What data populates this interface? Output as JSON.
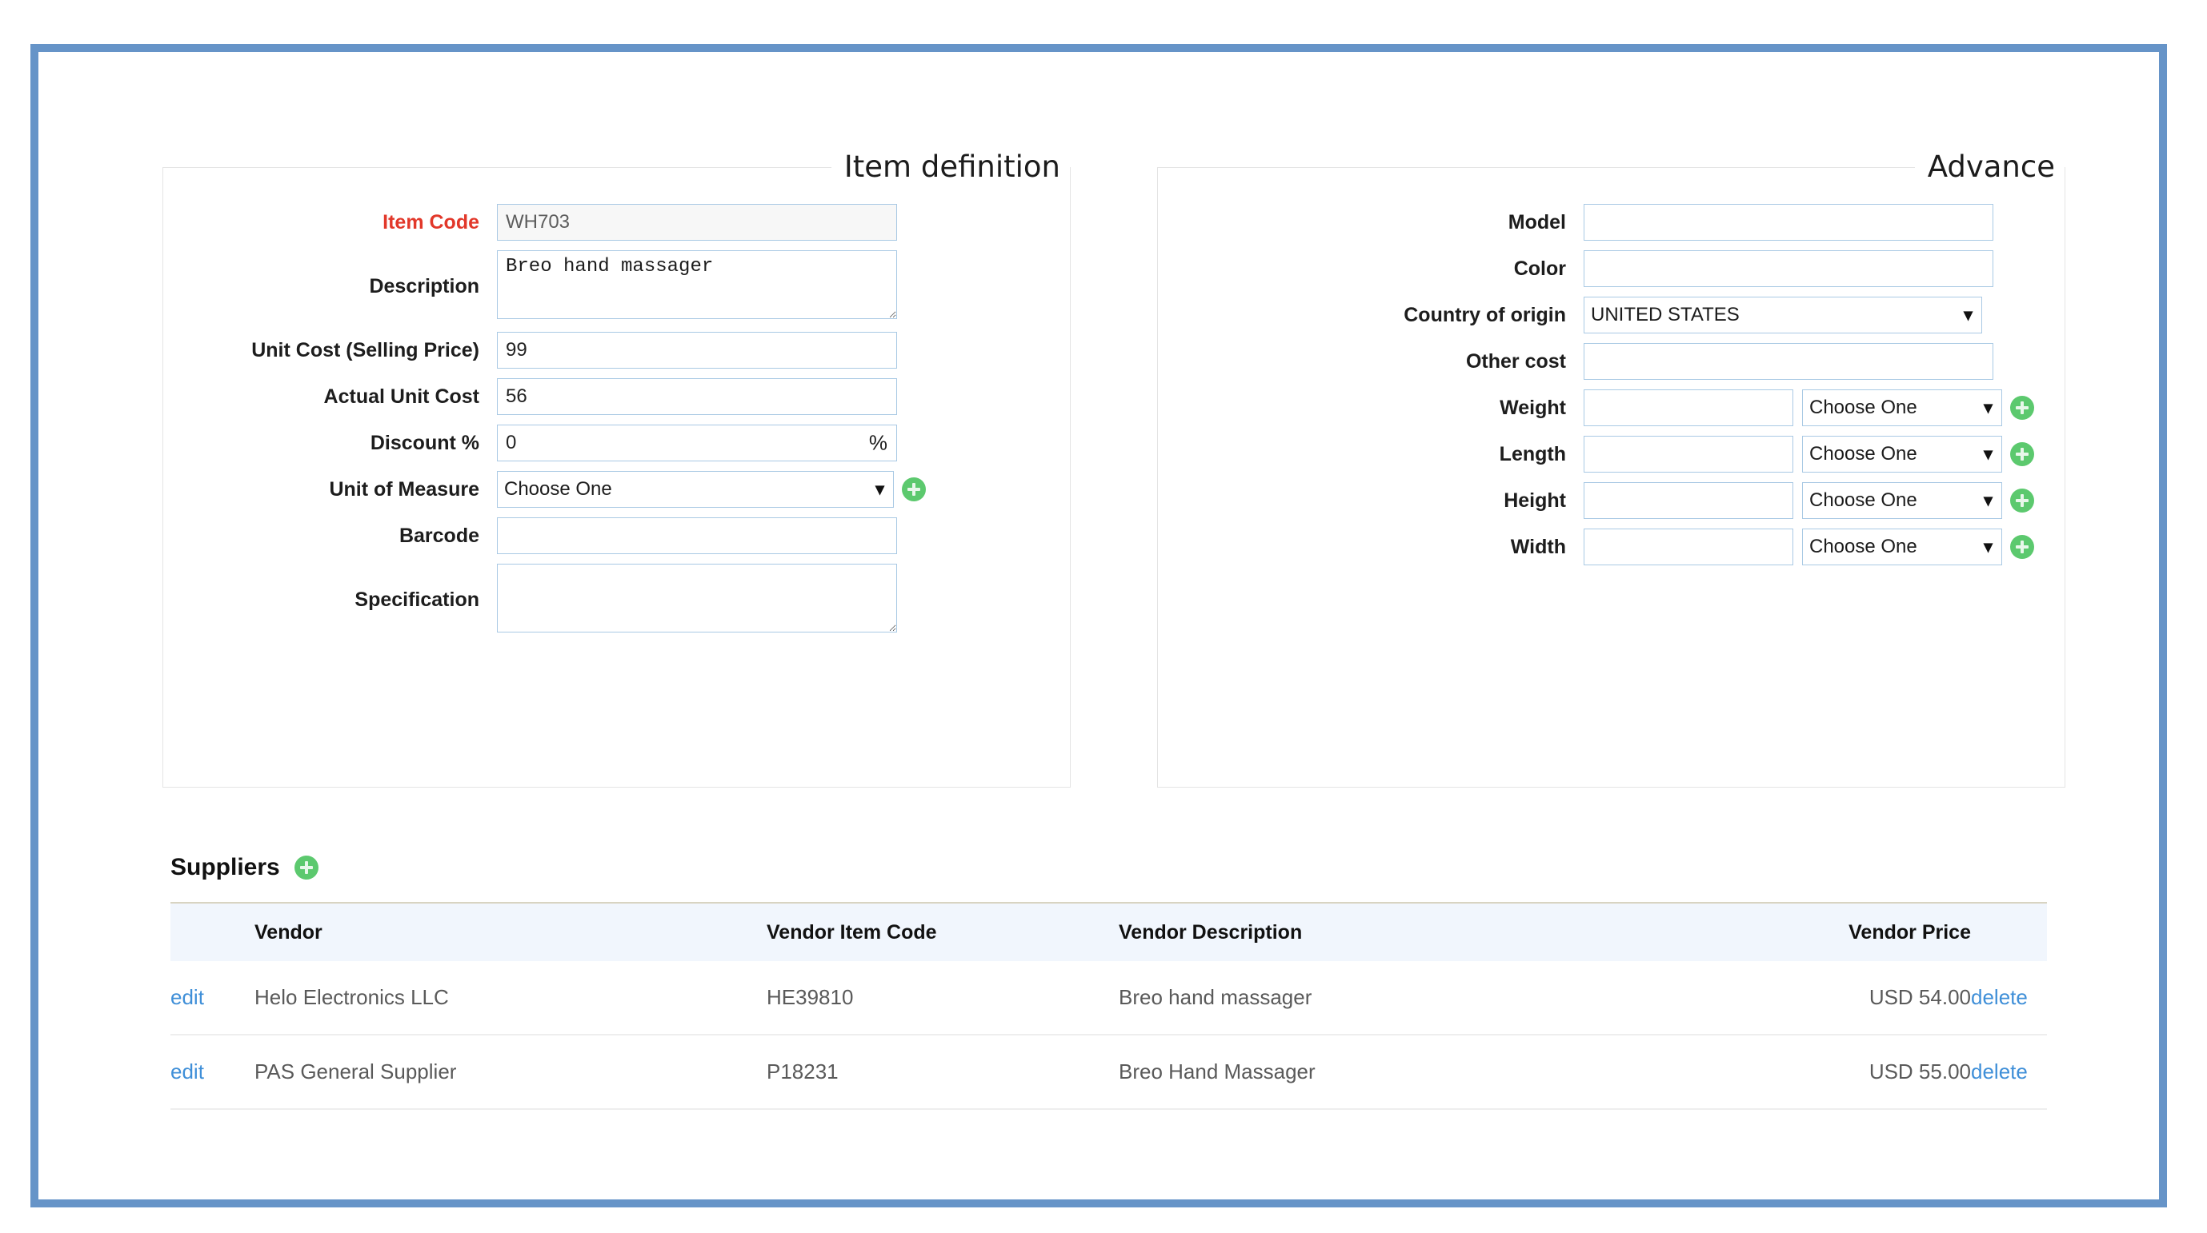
{
  "item_definition": {
    "legend": "Item definition",
    "fields": {
      "item_code": {
        "label": "Item Code",
        "value": "WH703",
        "required": true,
        "readonly": true
      },
      "description": {
        "label": "Description",
        "value": "Breo hand massager"
      },
      "unit_cost": {
        "label": "Unit Cost (Selling Price)",
        "value": "99"
      },
      "actual_unit_cost": {
        "label": "Actual Unit Cost",
        "value": "56"
      },
      "discount": {
        "label": "Discount %",
        "value": "0",
        "suffix": "%"
      },
      "unit_of_measure": {
        "label": "Unit of Measure",
        "selected": "Choose One",
        "options": [
          "Choose One"
        ],
        "add_icon": "plus-circle-icon"
      },
      "barcode": {
        "label": "Barcode",
        "value": ""
      },
      "specification": {
        "label": "Specification",
        "value": ""
      }
    }
  },
  "advance": {
    "legend": "Advance",
    "fields": {
      "model": {
        "label": "Model",
        "value": ""
      },
      "color": {
        "label": "Color",
        "value": ""
      },
      "country_of_origin": {
        "label": "Country of origin",
        "selected": "UNITED STATES",
        "options": [
          "UNITED STATES"
        ]
      },
      "other_cost": {
        "label": "Other cost",
        "value": ""
      },
      "weight": {
        "label": "Weight",
        "value": "",
        "unit_selected": "Choose One",
        "add_icon": "plus-circle-icon"
      },
      "length": {
        "label": "Length",
        "value": "",
        "unit_selected": "Choose One",
        "add_icon": "plus-circle-icon"
      },
      "height": {
        "label": "Height",
        "value": "",
        "unit_selected": "Choose One",
        "add_icon": "plus-circle-icon"
      },
      "width": {
        "label": "Width",
        "value": "",
        "unit_selected": "Choose One",
        "add_icon": "plus-circle-icon"
      }
    }
  },
  "suppliers": {
    "title": "Suppliers",
    "add_icon": "plus-circle-icon",
    "columns": {
      "edit": "",
      "vendor": "Vendor",
      "vendor_item_code": "Vendor Item Code",
      "vendor_description": "Vendor Description",
      "vendor_price": "Vendor Price",
      "delete": ""
    },
    "rows": [
      {
        "edit": "edit",
        "vendor": "Helo Electronics LLC",
        "vendor_item_code": "HE39810",
        "vendor_description": "Breo hand massager",
        "vendor_price": "USD 54.00",
        "delete": "delete"
      },
      {
        "edit": "edit",
        "vendor": "PAS General Supplier",
        "vendor_item_code": "P18231",
        "vendor_description": "Breo Hand Massager",
        "vendor_price": "USD 55.00",
        "delete": "delete"
      }
    ]
  },
  "colors": {
    "frame_blue": "#6694c8",
    "frame_blue_dark": "#3f6ea5",
    "required_red": "#e2382a",
    "link_blue": "#3f8fd8",
    "plus_green": "#5cc96e",
    "input_border": "#a9c9e4",
    "table_header_bg": "#f1f6fd"
  }
}
